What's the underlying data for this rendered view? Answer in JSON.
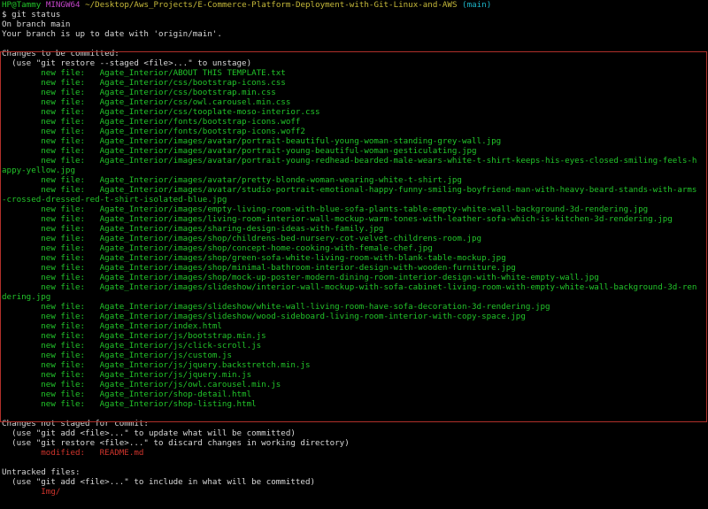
{
  "prompt": {
    "user_host": "HP@Tammy",
    "shell": "MINGW64",
    "path": "~/Desktop/Aws_Projects/E-Commerce-Platform-Deployment-with-Git-Linux-and-AWS",
    "branch": "(main)"
  },
  "command": "$ git status",
  "branch_info": [
    "On branch main",
    "Your branch is up to date with 'origin/main'."
  ],
  "staged": {
    "header": "Changes to be committed:",
    "hint": "  (use \"git restore --staged <file>...\" to unstage)",
    "prefix": "        new file:   ",
    "files": [
      "Agate_Interior/ABOUT THIS TEMPLATE.txt",
      "Agate_Interior/css/bootstrap-icons.css",
      "Agate_Interior/css/bootstrap.min.css",
      "Agate_Interior/css/owl.carousel.min.css",
      "Agate_Interior/css/tooplate-moso-interior.css",
      "Agate_Interior/fonts/bootstrap-icons.woff",
      "Agate_Interior/fonts/bootstrap-icons.woff2",
      "Agate_Interior/images/avatar/portrait-beautiful-young-woman-standing-grey-wall.jpg",
      "Agate_Interior/images/avatar/portrait-young-beautiful-woman-gesticulating.jpg",
      "Agate_Interior/images/avatar/portrait-young-redhead-bearded-male-wears-white-t-shirt-keeps-his-eyes-closed-smiling-feels-h|appy-yellow.jpg",
      "Agate_Interior/images/avatar/pretty-blonde-woman-wearing-white-t-shirt.jpg",
      "Agate_Interior/images/avatar/studio-portrait-emotional-happy-funny-smiling-boyfriend-man-with-heavy-beard-stands-with-arms|-crossed-dressed-red-t-shirt-isolated-blue.jpg",
      "Agate_Interior/images/empty-living-room-with-blue-sofa-plants-table-empty-white-wall-background-3d-rendering.jpg",
      "Agate_Interior/images/living-room-interior-wall-mockup-warm-tones-with-leather-sofa-which-is-kitchen-3d-rendering.jpg",
      "Agate_Interior/images/sharing-design-ideas-with-family.jpg",
      "Agate_Interior/images/shop/childrens-bed-nursery-cot-velvet-childrens-room.jpg",
      "Agate_Interior/images/shop/concept-home-cooking-with-female-chef.jpg",
      "Agate_Interior/images/shop/green-sofa-white-living-room-with-blank-table-mockup.jpg",
      "Agate_Interior/images/shop/minimal-bathroom-interior-design-with-wooden-furniture.jpg",
      "Agate_Interior/images/shop/mock-up-poster-modern-dining-room-interior-design-with-white-empty-wall.jpg",
      "Agate_Interior/images/slideshow/interior-wall-mockup-with-sofa-cabinet-living-room-with-empty-white-wall-background-3d-ren|dering.jpg",
      "Agate_Interior/images/slideshow/white-wall-living-room-have-sofa-decoration-3d-rendering.jpg",
      "Agate_Interior/images/slideshow/wood-sideboard-living-room-interior-with-copy-space.jpg",
      "Agate_Interior/index.html",
      "Agate_Interior/js/bootstrap.min.js",
      "Agate_Interior/js/click-scroll.js",
      "Agate_Interior/js/custom.js",
      "Agate_Interior/js/jquery.backstretch.min.js",
      "Agate_Interior/js/jquery.min.js",
      "Agate_Interior/js/owl.carousel.min.js",
      "Agate_Interior/shop-detail.html",
      "Agate_Interior/shop-listing.html"
    ]
  },
  "unstaged": {
    "header": "Changes not staged for commit:",
    "hints": [
      "  (use \"git add <file>...\" to update what will be committed)",
      "  (use \"git restore <file>...\" to discard changes in working directory)"
    ],
    "entries": [
      {
        "status": "        modified:   ",
        "file": "README.md"
      }
    ]
  },
  "untracked": {
    "header": "Untracked files:",
    "hint": "  (use \"git add <file>...\" to include in what will be committed)",
    "files": [
      "        Img/"
    ]
  },
  "colors": {
    "background": "#000000",
    "text": "#d8d8d8",
    "green": "#22c42a",
    "red": "#d0342c",
    "purple": "#c345c9",
    "yellow": "#c6b93a",
    "cyan": "#1cb5c9",
    "highlight_box": "#b0302a"
  }
}
